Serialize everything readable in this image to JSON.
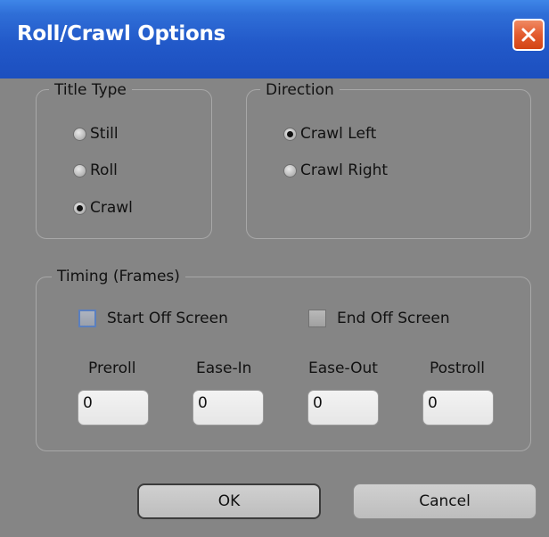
{
  "window": {
    "title": "Roll/Crawl Options"
  },
  "title_type": {
    "label": "Title Type",
    "options": [
      {
        "label": "Still",
        "checked": false
      },
      {
        "label": "Roll",
        "checked": false
      },
      {
        "label": "Crawl",
        "checked": true
      }
    ]
  },
  "direction": {
    "label": "Direction",
    "options": [
      {
        "label": "Crawl Left",
        "checked": true
      },
      {
        "label": "Crawl Right",
        "checked": false
      }
    ]
  },
  "timing": {
    "label": "Timing (Frames)",
    "start_off_screen": {
      "label": "Start Off Screen",
      "checked": false
    },
    "end_off_screen": {
      "label": "End Off Screen",
      "checked": false
    },
    "fields": [
      {
        "label": "Preroll",
        "value": "0"
      },
      {
        "label": "Ease-In",
        "value": "0"
      },
      {
        "label": "Ease-Out",
        "value": "0"
      },
      {
        "label": "Postroll",
        "value": "0"
      }
    ]
  },
  "buttons": {
    "ok": "OK",
    "cancel": "Cancel"
  },
  "colors": {
    "titlebar": "#2259c9",
    "panel": "#858585",
    "close": "#e35b2f"
  }
}
